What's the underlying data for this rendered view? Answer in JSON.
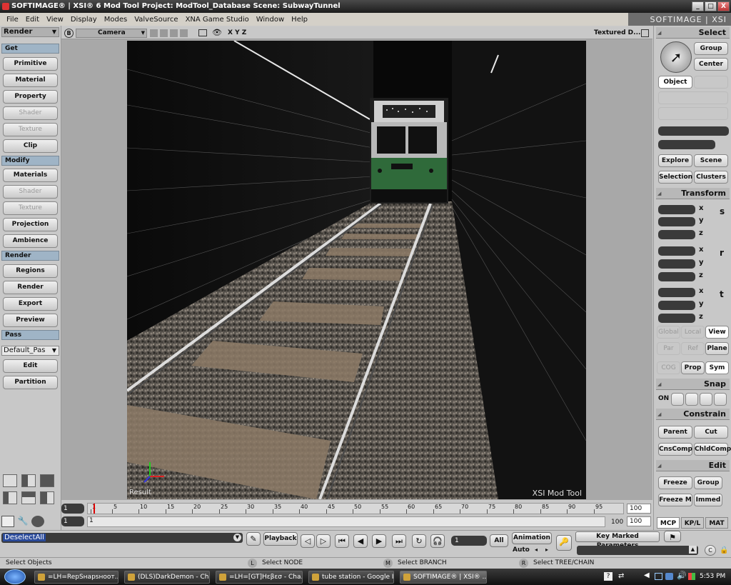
{
  "window": {
    "title": "SOFTIMAGE® | XSI® 6 Mod Tool Project: ModTool_Database    Scene: SubwayTunnel",
    "brand": "SOFTIMAGE | XSI",
    "controls": [
      "_",
      "□",
      "X"
    ]
  },
  "menu": [
    "File",
    "Edit",
    "View",
    "Display",
    "Modes",
    "ValveSource",
    "XNA Game Studio",
    "Window",
    "Help"
  ],
  "left_panel": {
    "mode": "Render",
    "sections": {
      "get": "Get",
      "modify": "Modify",
      "render": "Render",
      "pass": "Pass"
    },
    "get_buttons": [
      "Primitive",
      "Material",
      "Property",
      "Shader",
      "Texture",
      "Clip"
    ],
    "modify_buttons": [
      "Materials",
      "Shader",
      "Texture",
      "Projection",
      "Ambience"
    ],
    "render_buttons": [
      "Regions",
      "Render",
      "Export",
      "Preview"
    ],
    "pass_select": "Default_Pas",
    "pass_buttons": [
      "Edit",
      "Partition"
    ]
  },
  "viewport": {
    "letter": "B",
    "camera": "Camera",
    "axes": "X Y Z",
    "display_mode": "Textured D...",
    "result_label": "Result",
    "watermark": "XSI Mod Tool"
  },
  "right_panel": {
    "select_title": "Select",
    "group": "Group",
    "center": "Center",
    "object": "Object",
    "explore": "Explore",
    "scene": "Scene",
    "selection": "Selection",
    "clusters": "Clusters",
    "transform_title": "Transform",
    "axes": [
      "x",
      "y",
      "z"
    ],
    "transform_icons": [
      "s",
      "r",
      "t"
    ],
    "global": "Global",
    "local": "Local",
    "view": "View",
    "par": "Par",
    "ref": "Ref",
    "plane": "Plane",
    "cog": "COG",
    "prop": "Prop",
    "sym": "Sym",
    "snap_title": "Snap",
    "snap_on": "ON",
    "constrain_title": "Constrain",
    "parent": "Parent",
    "cut": "Cut",
    "cnscomp": "CnsComp",
    "chldcomp": "ChldComp",
    "edit_title": "Edit",
    "freeze": "Freeze",
    "edit_group": "Group",
    "freeze_m": "Freeze M",
    "immed": "Immed",
    "tabs": [
      "MCP",
      "KP/L",
      "MAT"
    ]
  },
  "timeline": {
    "start_top": "1",
    "start_bottom": "1",
    "current": "1",
    "end_top": "100",
    "end_bottom": "100",
    "range_end": "100",
    "ticks": [
      "1",
      "5",
      "10",
      "15",
      "20",
      "25",
      "30",
      "35",
      "40",
      "45",
      "50",
      "55",
      "60",
      "65",
      "70",
      "75",
      "80",
      "85",
      "90",
      "95"
    ]
  },
  "bottom": {
    "command": "DeselectAll",
    "playback": "Playback",
    "frame_value": "1",
    "all": "All",
    "animation": "Animation",
    "auto": "Auto",
    "key_marked": "Key Marked Parameters"
  },
  "status": {
    "main": "Select Objects",
    "l_key": "L",
    "l_text": "Select NODE",
    "m_key": "M",
    "m_text": "Select BRANCH",
    "r_key": "R",
    "r_text": "Select TREE/CHAIN"
  },
  "taskbar": {
    "tasks": [
      "=LH=RepSнарsнoот...",
      "(DLS)DarkDemon - Ch...",
      "=LH=[GT]Hεβεσ - Cha...",
      "tube station - Google I...",
      "SOFTIMAGE® | XSI® ..."
    ],
    "clock": "5:53 PM"
  },
  "colors": {
    "panel_bg": "#c8c8c8",
    "section_blue": "#9fb4c6",
    "train_green": "#2f6a3a",
    "command_highlight": "#2a4a9a"
  }
}
